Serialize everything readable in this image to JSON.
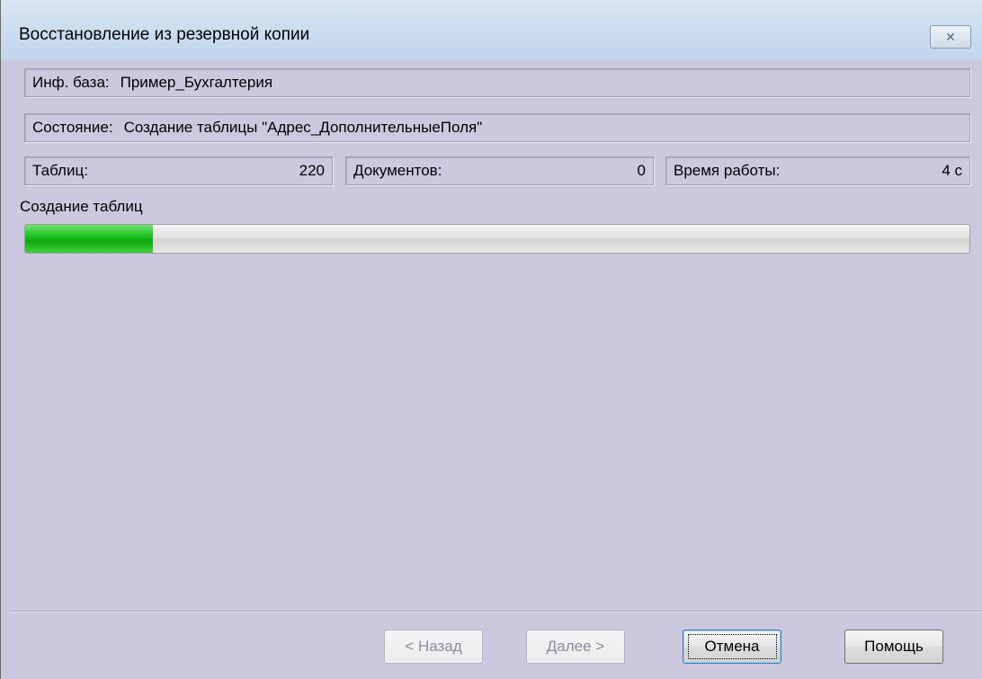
{
  "window": {
    "title": "Восстановление из резервной копии",
    "close_glyph": "✕"
  },
  "infobase": {
    "label": "Инф. база:",
    "value": "Пример_Бухгалтерия"
  },
  "status": {
    "label": "Состояние:",
    "value": "Создание таблицы \"Адрес_ДополнительныеПоля\""
  },
  "stats": {
    "tables": {
      "label": "Таблиц:",
      "value": "220"
    },
    "documents": {
      "label": "Документов:",
      "value": "0"
    },
    "runtime": {
      "label": "Время работы:",
      "value": "4 с"
    }
  },
  "progress": {
    "label": "Создание таблиц",
    "fraction": 0.135,
    "color": "#1cc21c"
  },
  "buttons": {
    "back": "< Назад",
    "next": "Далее >",
    "cancel": "Отмена",
    "help": "Помощь"
  }
}
